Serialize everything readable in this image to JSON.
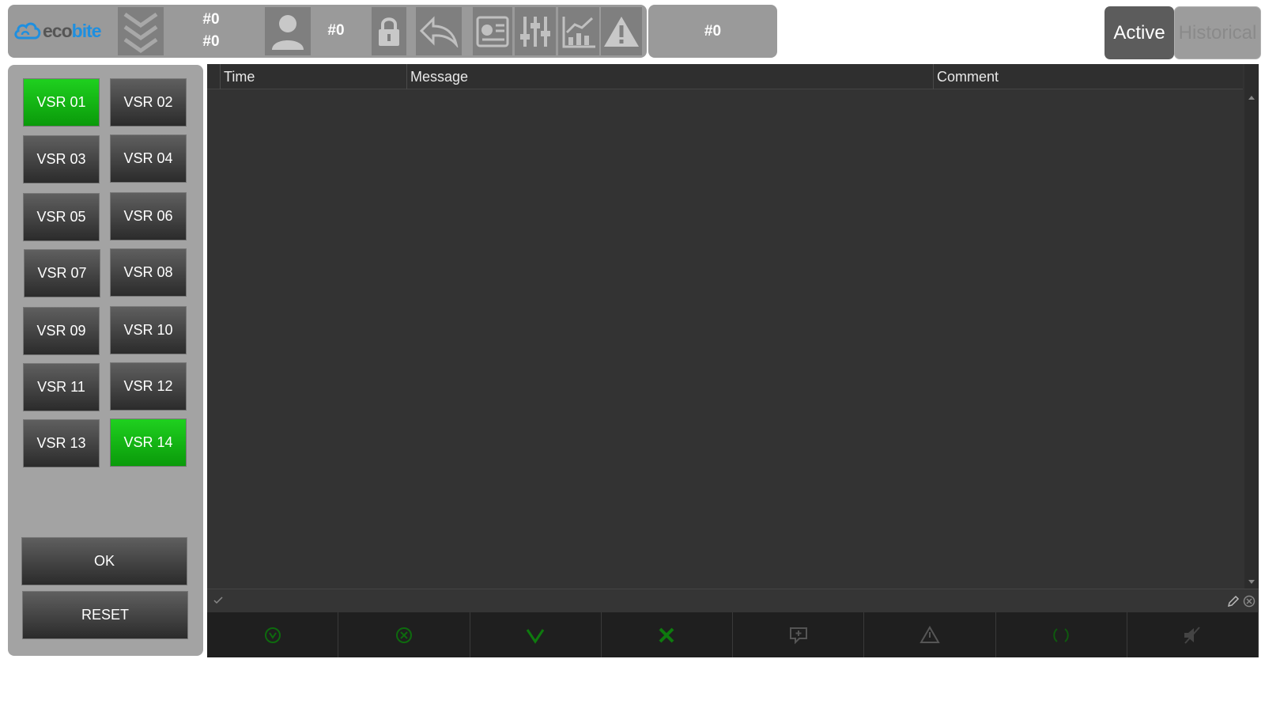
{
  "brand": {
    "logo_eco": "eco",
    "logo_bite": "bite"
  },
  "topbar": {
    "counter_a": "#0",
    "counter_b": "#0",
    "user_count": "#0",
    "status_value": "#0"
  },
  "mode": {
    "active_label": "Active",
    "historical_label": "Historical"
  },
  "vsr_buttons": [
    {
      "label": "VSR 01",
      "active": true
    },
    {
      "label": "VSR 02",
      "active": false
    },
    {
      "label": "VSR 03",
      "active": false
    },
    {
      "label": "VSR 04",
      "active": false
    },
    {
      "label": "VSR 05",
      "active": false
    },
    {
      "label": "VSR 06",
      "active": false
    },
    {
      "label": "VSR 07",
      "active": false
    },
    {
      "label": "VSR 08",
      "active": false
    },
    {
      "label": "VSR 09",
      "active": false
    },
    {
      "label": "VSR 10",
      "active": false
    },
    {
      "label": "VSR 11",
      "active": false
    },
    {
      "label": "VSR 12",
      "active": false
    },
    {
      "label": "VSR 13",
      "active": false
    },
    {
      "label": "VSR 14",
      "active": true
    }
  ],
  "actions": {
    "ok_label": "OK",
    "reset_label": "RESET"
  },
  "grid": {
    "columns": [
      "Time",
      "Message",
      "Comment"
    ],
    "rows": []
  },
  "colors": {
    "active_green": "#1fd01f",
    "tool_green": "#0e7a0e",
    "brand_blue": "#1e8fe0"
  },
  "toolbar_icons": [
    "acknowledge-circle-icon",
    "cancel-circle-icon",
    "check-icon",
    "close-icon",
    "add-comment-icon",
    "warning-icon",
    "refresh-icon",
    "mute-icon"
  ]
}
